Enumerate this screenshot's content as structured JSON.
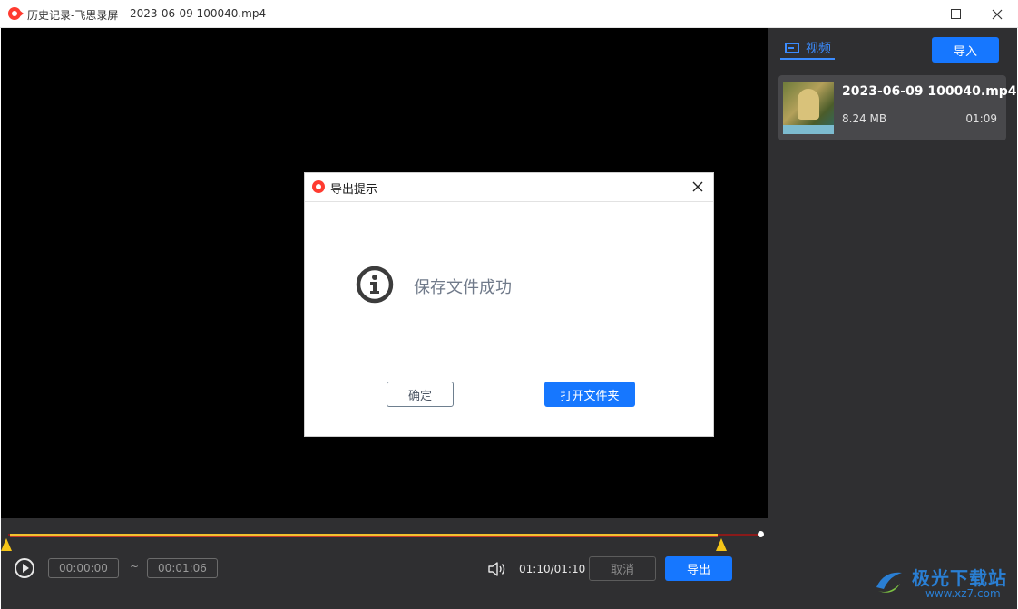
{
  "window": {
    "app_title": "历史记录-飞思录屏",
    "file_title": "2023-06-09 100040.mp4",
    "controls": [
      "minimize-icon",
      "maximize-icon",
      "close-icon"
    ]
  },
  "player": {
    "start_time": "00:00:00",
    "range_separator": "~",
    "end_time": "00:01:06",
    "time_readout": "01:10/01:10",
    "cancel_label": "取消",
    "export_label": "导出"
  },
  "sidebar": {
    "tab_label": "视频",
    "import_label": "导入",
    "files": [
      {
        "name": "2023-06-09 100040.mp4",
        "size": "8.24 MB",
        "duration": "01:09"
      }
    ]
  },
  "dialog": {
    "title": "导出提示",
    "message": "保存文件成功",
    "ok_label": "确定",
    "open_folder_label": "打开文件夹"
  },
  "watermark": {
    "text": "极光下载站",
    "url": "www.xz7.com"
  },
  "colors": {
    "accent": "#1677ff",
    "panel": "#2f2f31",
    "trim_marker": "#f5c518",
    "brand_red": "#ff3b30"
  }
}
